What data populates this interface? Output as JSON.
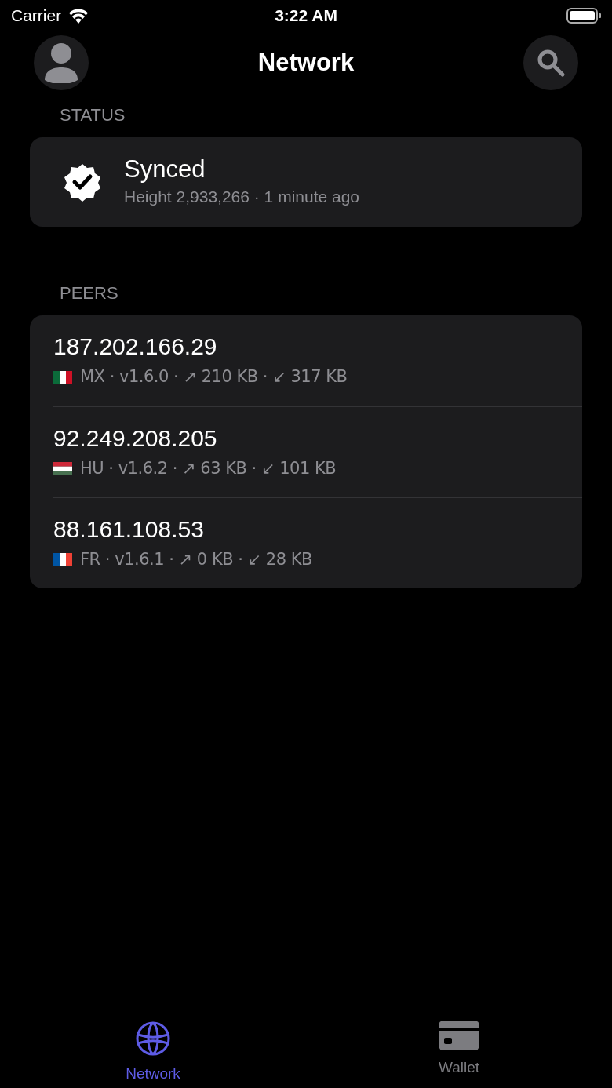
{
  "status_bar": {
    "carrier": "Carrier",
    "time": "3:22 AM"
  },
  "nav": {
    "title": "Network"
  },
  "status_section": {
    "header": "STATUS",
    "title": "Synced",
    "detail": "Height 2,933,266 · 1 minute ago"
  },
  "peers_section": {
    "header": "PEERS",
    "peers": [
      {
        "address": "187.202.166.29",
        "kind": "mx",
        "info": "MX · v1.6.0 · ↗ 210 KB · ↙ 317 KB"
      },
      {
        "address": "92.249.208.205",
        "kind": "hu",
        "info": "HU · v1.6.2 · ↗ 63 KB · ↙ 101 KB"
      },
      {
        "address": "88.161.108.53",
        "kind": "fr",
        "info": "FR · v1.6.1 · ↗ 0 KB · ↙ 28 KB"
      }
    ]
  },
  "tab_bar": [
    {
      "label": "Network",
      "kind": "globe",
      "selected": true
    },
    {
      "label": "Wallet",
      "kind": "card",
      "selected": false
    }
  ]
}
